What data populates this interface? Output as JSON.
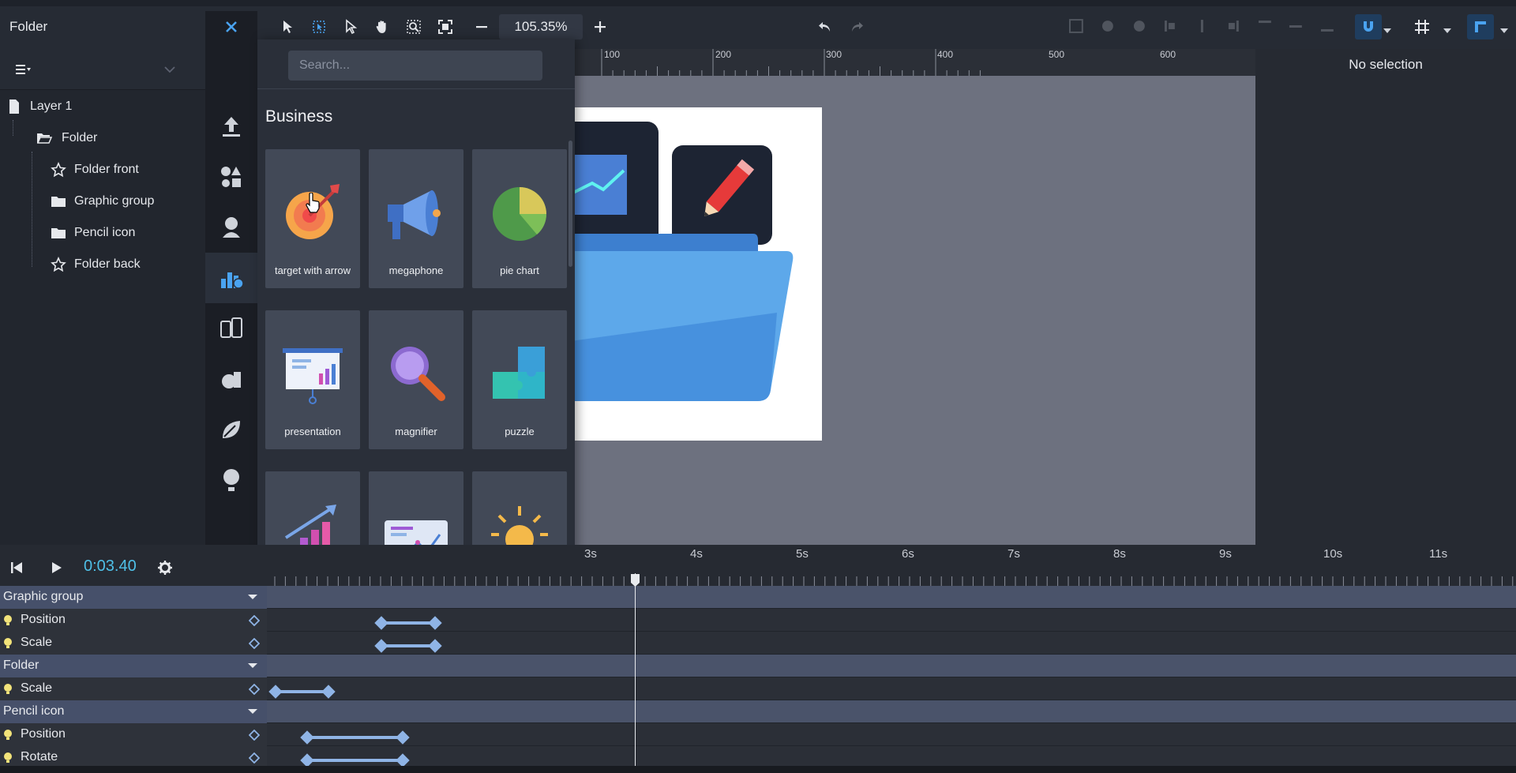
{
  "topbar": {
    "title": "Folder",
    "zoom": "105.35%"
  },
  "layers": {
    "items": [
      {
        "label": "Layer 1"
      },
      {
        "label": "Folder"
      },
      {
        "label": "Folder front"
      },
      {
        "label": "Graphic group"
      },
      {
        "label": "Pencil icon"
      },
      {
        "label": "Folder back"
      }
    ]
  },
  "library": {
    "search_placeholder": "Search...",
    "category": "Business",
    "tiles": [
      {
        "label": "target with arrow",
        "icon": "target-arrow-icon"
      },
      {
        "label": "megaphone",
        "icon": "megaphone-icon"
      },
      {
        "label": "pie chart",
        "icon": "pie-chart-icon"
      },
      {
        "label": "presentation",
        "icon": "presentation-icon"
      },
      {
        "label": "magnifier",
        "icon": "magnifier-icon"
      },
      {
        "label": "puzzle",
        "icon": "puzzle-icon"
      },
      {
        "label": "",
        "icon": "growth-chart-icon"
      },
      {
        "label": "",
        "icon": "dashboard-icon"
      },
      {
        "label": "",
        "icon": "lightbulb-icon"
      }
    ]
  },
  "ruler": {
    "marks": [
      "100",
      "200",
      "300",
      "400",
      "500",
      "600"
    ]
  },
  "properties": {
    "title": "No selection"
  },
  "timeline": {
    "time": "0:03.40",
    "seconds": [
      "3s",
      "4s",
      "5s",
      "6s",
      "7s",
      "8s",
      "9s",
      "10s",
      "11s"
    ],
    "tracks": [
      {
        "label": "Graphic group",
        "kind": "group"
      },
      {
        "label": "Position",
        "kind": "prop"
      },
      {
        "label": "Scale",
        "kind": "prop"
      },
      {
        "label": "Folder",
        "kind": "group"
      },
      {
        "label": "Scale",
        "kind": "prop"
      },
      {
        "label": "Pencil icon",
        "kind": "group"
      },
      {
        "label": "Position",
        "kind": "prop"
      },
      {
        "label": "Rotate",
        "kind": "prop"
      }
    ]
  },
  "colors": {
    "accent": "#4aa3f0",
    "time": "#4fc0e8",
    "keyframe": "#8fb4e6"
  }
}
